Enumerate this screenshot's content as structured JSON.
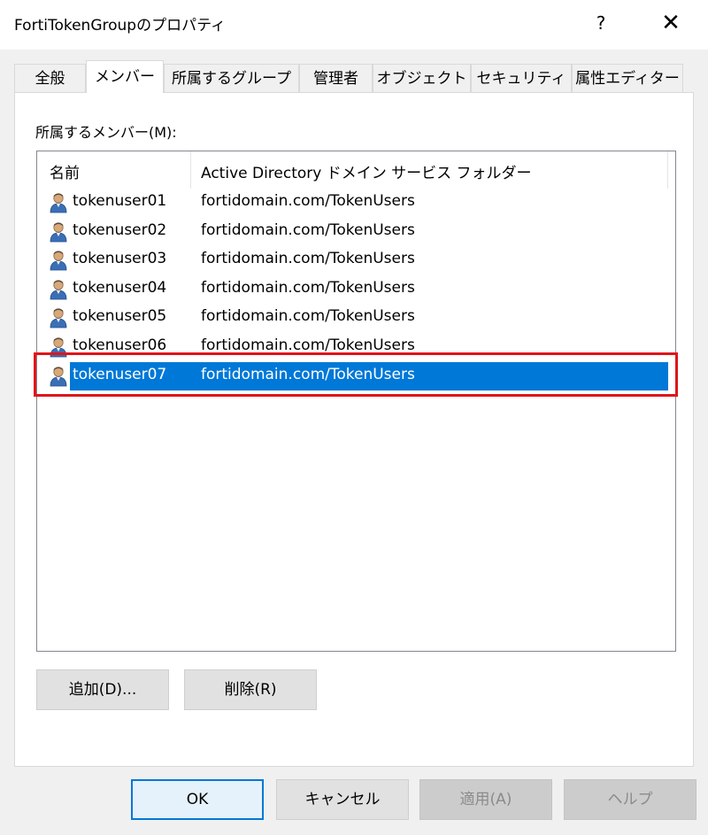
{
  "window": {
    "title": "FortiTokenGroupのプロパティ",
    "help": "?",
    "close": "✕"
  },
  "tabs": [
    "全般",
    "メンバー",
    "所属するグループ",
    "管理者",
    "オブジェクト",
    "セキュリティ",
    "属性エディター"
  ],
  "active_tab": "メンバー",
  "members": {
    "label": "所属するメンバー(M):",
    "columns": {
      "name": "名前",
      "folder": "Active Directory ドメイン サービス フォルダー"
    },
    "rows": [
      {
        "name": "tokenuser01",
        "folder": "fortidomain.com/TokenUsers"
      },
      {
        "name": "tokenuser02",
        "folder": "fortidomain.com/TokenUsers"
      },
      {
        "name": "tokenuser03",
        "folder": "fortidomain.com/TokenUsers"
      },
      {
        "name": "tokenuser04",
        "folder": "fortidomain.com/TokenUsers"
      },
      {
        "name": "tokenuser05",
        "folder": "fortidomain.com/TokenUsers"
      },
      {
        "name": "tokenuser06",
        "folder": "fortidomain.com/TokenUsers"
      },
      {
        "name": "tokenuser07",
        "folder": "fortidomain.com/TokenUsers"
      }
    ],
    "selected_row": "tokenuser07",
    "row_icon": "user-icon"
  },
  "buttons": {
    "add": "追加(D)...",
    "remove": "削除(R)",
    "ok": "OK",
    "cancel": "キャンセル",
    "apply": "適用(A)",
    "help": "ヘルプ"
  },
  "colors": {
    "selection": "#0078d7",
    "highlight_box": "#e0151b"
  }
}
